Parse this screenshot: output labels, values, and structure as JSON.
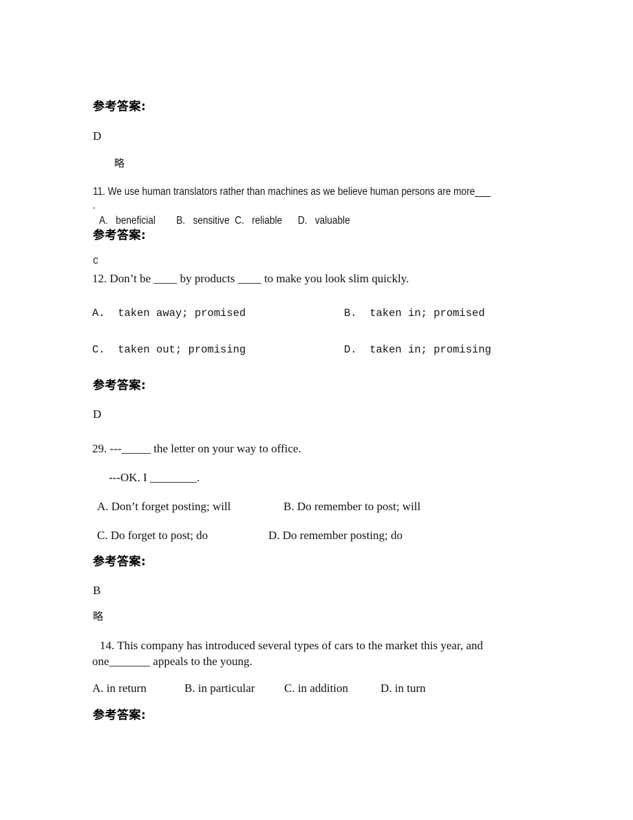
{
  "document": {
    "type": "exam-answer-key",
    "language": "zh-CN + en",
    "answer_label": "参考答案:",
    "omitted_label": "略"
  },
  "blocks": [
    {
      "id": "answer-0",
      "label": "参考答案:",
      "answer": "D",
      "note": "略"
    },
    {
      "id": "question-11",
      "number": "11.",
      "stem_line1": "11. We use human translators rather than machines as we believe human persons are more___",
      "stem_line2": ".",
      "options_line": "A.   beneficial        B.   sensitive  C.   reliable      D.   valuable",
      "options": [
        {
          "letter": "A.",
          "text": "beneficial"
        },
        {
          "letter": "B.",
          "text": "sensitive"
        },
        {
          "letter": "C.",
          "text": "reliable"
        },
        {
          "letter": "D.",
          "text": "valuable"
        }
      ]
    },
    {
      "id": "answer-11",
      "label": "参考答案:",
      "answer": "C"
    },
    {
      "id": "question-12",
      "number": "12.",
      "stem": "12. Don’t be ____ by products ____ to make you look slim quickly.",
      "options": [
        {
          "letter": "A.",
          "text": "taken away; promised"
        },
        {
          "letter": "B.",
          "text": "taken in; promised"
        },
        {
          "letter": "C.",
          "text": "taken out; promising"
        },
        {
          "letter": "D.",
          "text": "taken in; promising"
        }
      ],
      "option_a": "A.  taken away; promised",
      "option_b": "B.  taken in; promised",
      "option_c": "C.  taken out; promising",
      "option_d": "D.  taken in; promising"
    },
    {
      "id": "answer-12",
      "label": "参考答案:",
      "answer": "D"
    },
    {
      "id": "question-29",
      "number": "29.",
      "stem_line1": "29. ---_____ the letter on your way to office.",
      "stem_line2": "---OK. I ________.",
      "option_a": "A. Don’t forget posting; will",
      "option_b": "B. Do remember to post; will",
      "option_c": "C. Do forget to post; do",
      "option_d": "D. Do remember posting; do"
    },
    {
      "id": "answer-29",
      "label": "参考答案:",
      "answer": "B",
      "note": "略"
    },
    {
      "id": "question-14",
      "number": "14.",
      "stem_line1": "14. This company has introduced several types of cars to the market this year, and",
      "stem_line2": "one_______ appeals to the young.",
      "option_a": "A. in return",
      "option_b": "B. in particular",
      "option_c": "C. in addition",
      "option_d": "D. in turn"
    },
    {
      "id": "answer-14",
      "label": "参考答案:"
    }
  ]
}
